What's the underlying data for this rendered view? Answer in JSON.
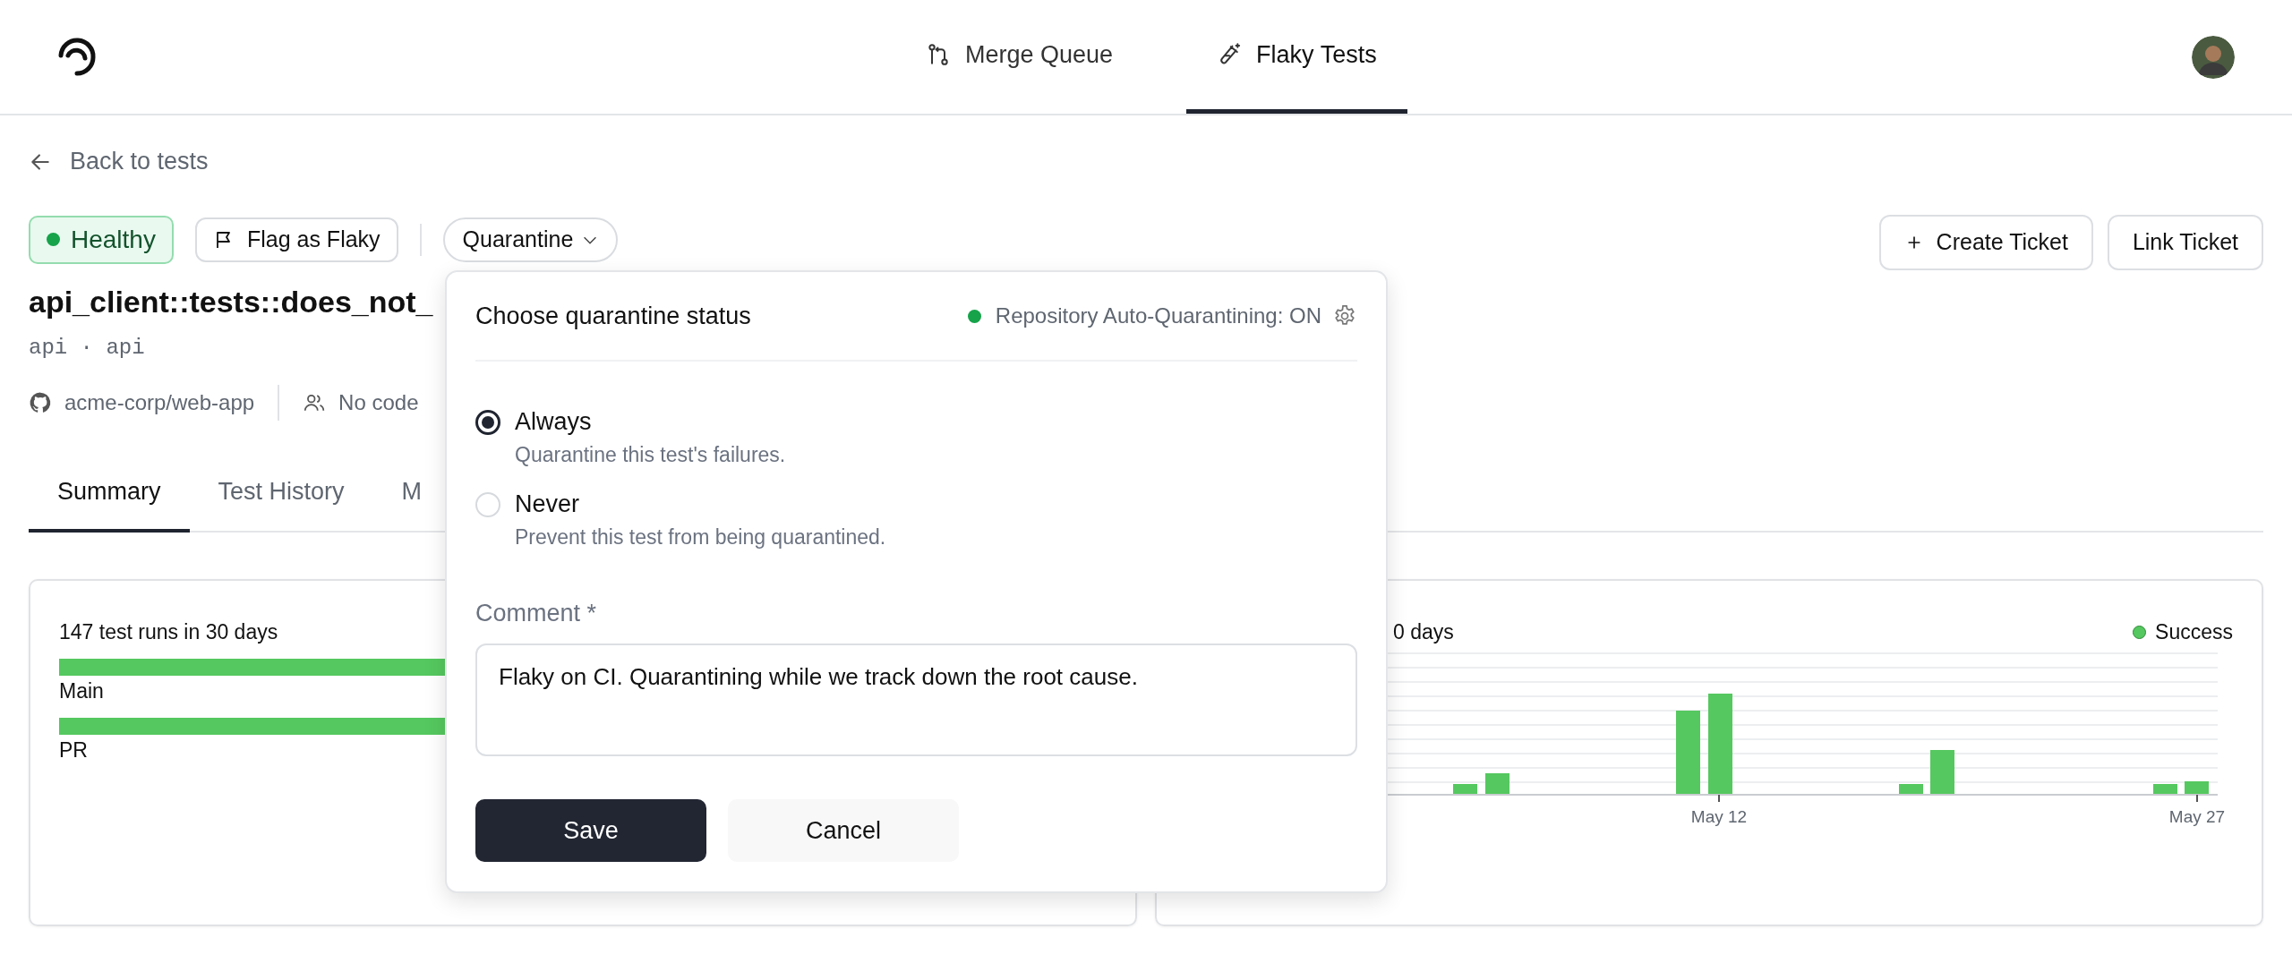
{
  "nav": {
    "tabs": [
      {
        "label": "Merge Queue",
        "kind": "merge",
        "selected": false
      },
      {
        "label": "Flaky Tests",
        "kind": "flaky",
        "selected": true
      }
    ]
  },
  "back_link": "Back to tests",
  "status_badge": {
    "label": "Healthy"
  },
  "actions": {
    "flag": "Flag as Flaky",
    "quarantine": "Quarantine",
    "create_ticket": "Create Ticket",
    "link_ticket": "Link Ticket"
  },
  "test": {
    "name": "api_client::tests::does_not_",
    "tags": "api · api",
    "repo": "acme-corp/web-app",
    "owners": "No code"
  },
  "tabs": [
    {
      "label": "Summary",
      "selected": true
    },
    {
      "label": "Test History",
      "selected": false
    },
    {
      "label": "M",
      "selected": false
    }
  ],
  "runs_card": {
    "title": "147 test runs in 30 days",
    "rows": [
      {
        "label": "Main"
      },
      {
        "label": "PR"
      }
    ]
  },
  "chart_card": {
    "title": "0 days",
    "legend": "Success",
    "x_labels": [
      "May 12",
      "May 27"
    ]
  },
  "popup": {
    "title": "Choose quarantine status",
    "auto_status": "Repository Auto-Quarantining: ON",
    "options": [
      {
        "label": "Always",
        "description": "Quarantine this test's failures.",
        "selected": true
      },
      {
        "label": "Never",
        "description": "Prevent this test from being quarantined.",
        "selected": false
      }
    ],
    "comment": {
      "label": "Comment *",
      "value": "Flaky on CI. Quarantining while we track down the root cause."
    },
    "buttons": {
      "save": "Save",
      "cancel": "Cancel"
    }
  }
}
